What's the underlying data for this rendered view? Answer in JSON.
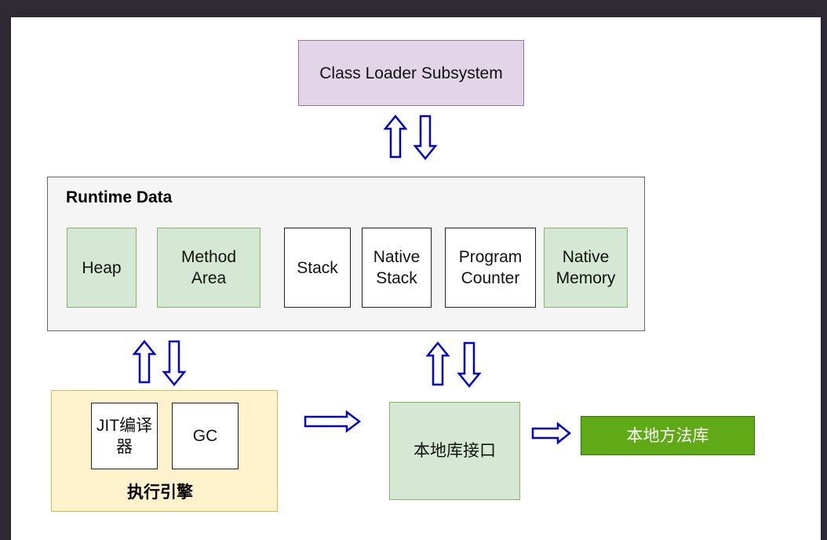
{
  "class_loader": {
    "label": "Class Loader Subsystem"
  },
  "runtime_data": {
    "title": "Runtime Data",
    "areas": [
      {
        "label": "Heap",
        "style": "green"
      },
      {
        "label": "Method Area",
        "style": "green"
      },
      {
        "label": "Stack",
        "style": "white"
      },
      {
        "label": "Native Stack",
        "style": "white"
      },
      {
        "label": "Program Counter",
        "style": "white"
      },
      {
        "label": "Native Memory",
        "style": "green"
      }
    ]
  },
  "execution_engine": {
    "title": "执行引擎",
    "components": [
      {
        "label": "JIT编译器"
      },
      {
        "label": "GC"
      }
    ]
  },
  "native_interface": {
    "label": "本地库接口"
  },
  "native_library": {
    "label": "本地方法库"
  },
  "colors": {
    "arrow": "#0000cc",
    "class_loader_fill": "#e1d5e7",
    "green_fill": "#d5e8d4",
    "engine_fill": "#fff2cc",
    "native_library_fill": "#60a917"
  }
}
